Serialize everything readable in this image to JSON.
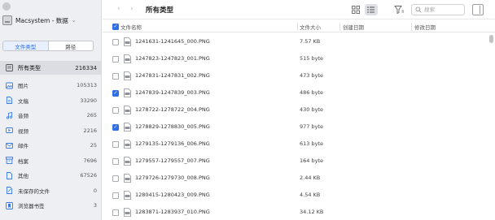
{
  "sidebar": {
    "device_name": "Macsystem - 数据",
    "tabs": [
      {
        "label": "文件类型",
        "active": true
      },
      {
        "label": "路径",
        "active": false
      }
    ],
    "categories": [
      {
        "label": "所有类型",
        "count": "216334",
        "icon": "all-types-icon",
        "active": true
      },
      {
        "label": "图片",
        "count": "105313",
        "icon": "image-icon"
      },
      {
        "label": "文稿",
        "count": "33290",
        "icon": "document-icon"
      },
      {
        "label": "音频",
        "count": "265",
        "icon": "music-icon"
      },
      {
        "label": "视频",
        "count": "2216",
        "icon": "video-icon"
      },
      {
        "label": "邮件",
        "count": "25",
        "icon": "mail-icon"
      },
      {
        "label": "档案",
        "count": "7696",
        "icon": "archive-icon"
      },
      {
        "label": "其他",
        "count": "67526",
        "icon": "other-icon"
      },
      {
        "label": "未保存的文件",
        "count": "0",
        "icon": "unsaved-file-icon"
      },
      {
        "label": "浏览器书签",
        "count": "3",
        "icon": "bookmark-icon"
      }
    ]
  },
  "toolbar": {
    "title": "所有类型",
    "search_placeholder": "搜索"
  },
  "table": {
    "columns": {
      "name": "文件名称",
      "size": "文件大小",
      "created": "创建日期",
      "modified": "修改日期"
    },
    "rows": [
      {
        "name": "1241631-1241645_000.PNG",
        "size": "7.57 KB",
        "checked": false
      },
      {
        "name": "1247823-1247823_001.PNG",
        "size": "515 byte",
        "checked": false
      },
      {
        "name": "1247831-1247831_002.PNG",
        "size": "473 byte",
        "checked": false
      },
      {
        "name": "1247839-1247839_003.PNG",
        "size": "486 byte",
        "checked": true
      },
      {
        "name": "1278722-1278722_004.PNG",
        "size": "430 byte",
        "checked": false
      },
      {
        "name": "1278829-1278830_005.PNG",
        "size": "977 byte",
        "checked": true
      },
      {
        "name": "1279135-1279136_006.PNG",
        "size": "613 byte",
        "checked": false
      },
      {
        "name": "1279557-1279557_007.PNG",
        "size": "164 byte",
        "checked": false
      },
      {
        "name": "1279726-1279730_008.PNG",
        "size": "2.44 KB",
        "checked": false
      },
      {
        "name": "1280415-1280423_009.PNG",
        "size": "4.54 KB",
        "checked": false
      },
      {
        "name": "1283871-1283937_010.PNG",
        "size": "34.12 KB",
        "checked": false
      }
    ]
  },
  "colors": {
    "accent": "#2f6fe5",
    "sidebar_bg": "#eeeff2",
    "selected_bg": "#dcdde2"
  }
}
